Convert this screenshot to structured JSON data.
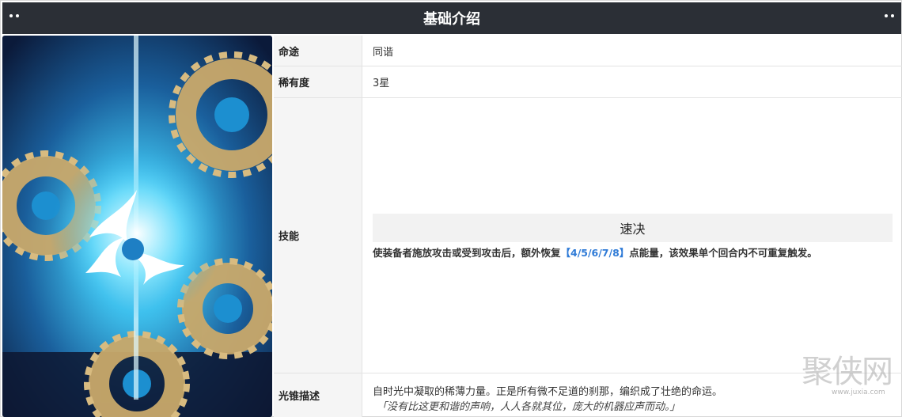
{
  "header": {
    "title": "基础介绍"
  },
  "table": {
    "path_label": "命途",
    "path_value": "同谐",
    "rarity_label": "稀有度",
    "rarity_value": "3星",
    "skill_label": "技能",
    "skill_name": "速决",
    "skill_desc_before": "使装备者施放攻击或受到攻击后，额外恢复",
    "skill_desc_highlight": "【4/5/6/7/8】",
    "skill_desc_after": "点能量，该效果单个回合内不可重复触发。",
    "lore_label": "光锥描述",
    "lore_line1": "自时光中凝取的稀薄力量。正是所有微不足道的刹那，编织成了壮绝的命运。",
    "lore_line2": "「没有比这更和谐的声响，人人各就其位，庞大的机器应声而动。」"
  },
  "watermark": {
    "text": "聚侠网",
    "url": "www.juxia.com"
  },
  "colors": {
    "header_bg": "#2b2f36",
    "label_bg": "#f5f5f5",
    "highlight": "#2f7bd7"
  }
}
